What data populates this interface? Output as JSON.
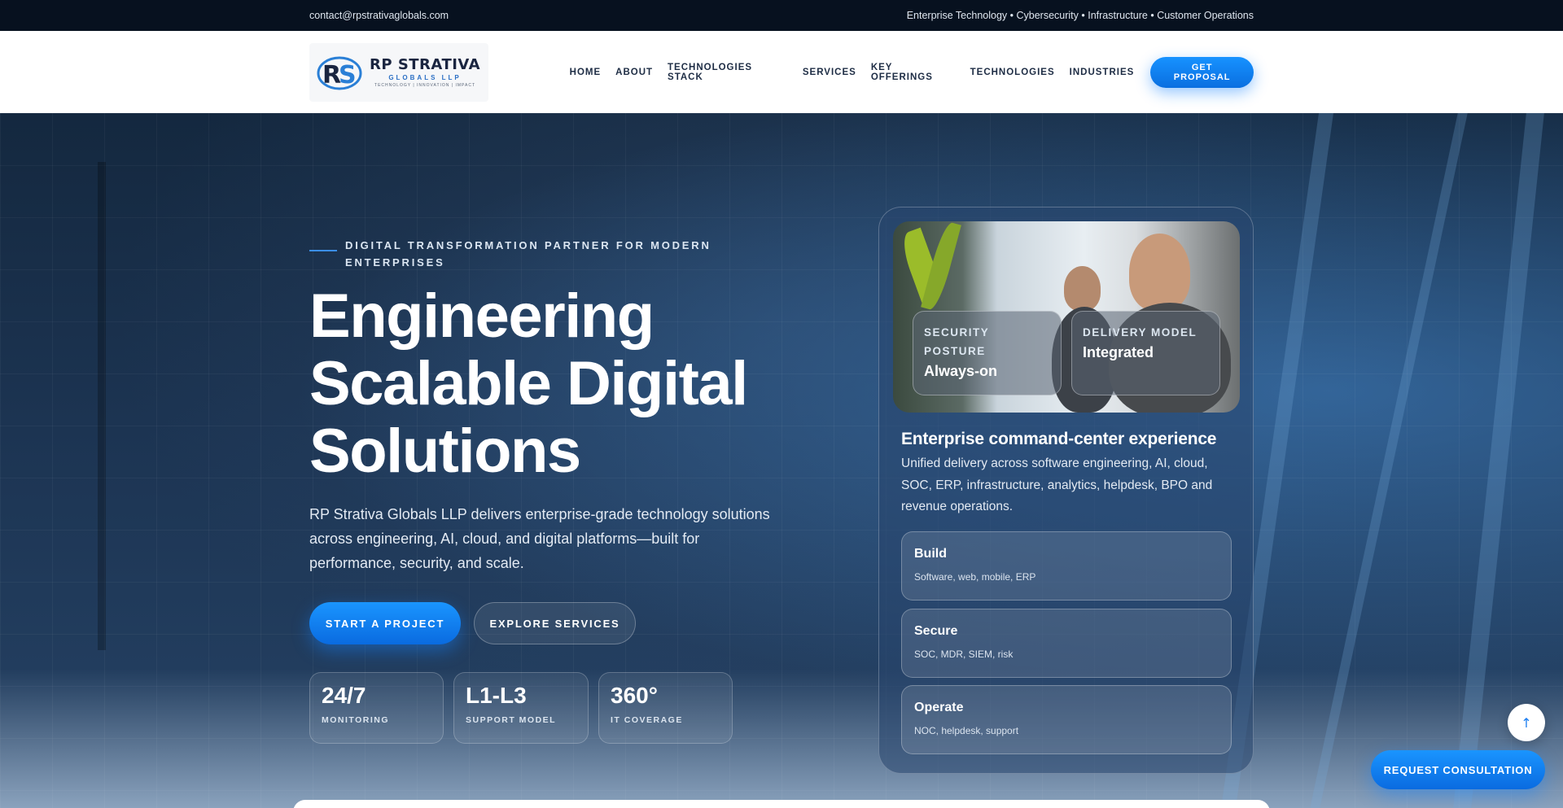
{
  "topbar": {
    "email": "contact@rpstrativaglobals.com",
    "tagline": "Enterprise Technology • Cybersecurity • Infrastructure • Customer Operations"
  },
  "header": {
    "logo": {
      "title": "RP STRATIVA",
      "subtitle": "GLOBALS LLP",
      "tagline": "TECHNOLOGY | INNOVATION | IMPACT"
    },
    "nav": [
      "HOME",
      "ABOUT",
      "TECHNOLOGIES STACK",
      "SERVICES",
      "KEY OFFERINGS",
      "TECHNOLOGIES",
      "INDUSTRIES"
    ],
    "cta_label": "GET PROPOSAL"
  },
  "hero": {
    "eyebrow": "DIGITAL TRANSFORMATION PARTNER FOR MODERN ENTERPRISES",
    "title": "Engineering Scalable Digital Solutions",
    "description": "RP Strativa Globals LLP delivers enterprise-grade technology solutions across engineering, AI, cloud, and digital platforms—built for performance, security, and scale.",
    "primary_cta": "START A PROJECT",
    "secondary_cta": "EXPLORE SERVICES",
    "stats": [
      {
        "value": "24/7",
        "label": "MONITORING"
      },
      {
        "value": "L1-L3",
        "label": "SUPPORT MODEL"
      },
      {
        "value": "360°",
        "label": "IT COVERAGE"
      }
    ]
  },
  "card": {
    "badges": [
      {
        "label": "SECURITY POSTURE",
        "value": "Always-on"
      },
      {
        "label": "DELIVERY MODEL",
        "value": "Integrated"
      }
    ],
    "title": "Enterprise command-center experience",
    "description": "Unified delivery across software engineering, AI, cloud, SOC, ERP, infrastructure, analytics, helpdesk, BPO and revenue operations.",
    "items": [
      {
        "title": "Build",
        "desc": "Software, web, mobile, ERP"
      },
      {
        "title": "Secure",
        "desc": "SOC, MDR, SIEM, risk"
      },
      {
        "title": "Operate",
        "desc": "NOC, helpdesk, support"
      }
    ]
  },
  "floating": {
    "back_to_top": "↑",
    "consult_label": "REQUEST CONSULTATION"
  },
  "colors": {
    "accent": "#0a7cf5",
    "navy": "#07111f",
    "nav_text": "#1d2c44"
  }
}
